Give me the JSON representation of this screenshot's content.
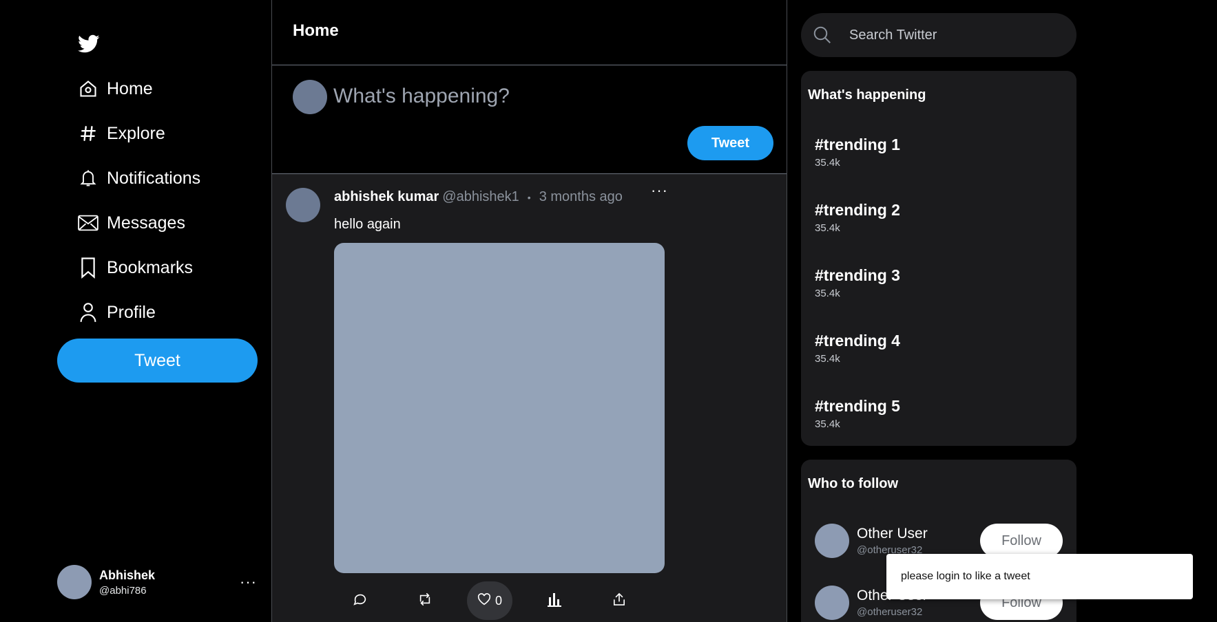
{
  "nav": {
    "items": [
      {
        "label": "Home",
        "icon": "home-icon"
      },
      {
        "label": "Explore",
        "icon": "hash-icon"
      },
      {
        "label": "Notifications",
        "icon": "bell-icon"
      },
      {
        "label": "Messages",
        "icon": "envelope-icon"
      },
      {
        "label": "Bookmarks",
        "icon": "bookmark-icon"
      },
      {
        "label": "Profile",
        "icon": "person-icon"
      }
    ],
    "tweet_button": "Tweet"
  },
  "account": {
    "name": "Abhishek",
    "handle": "@abhi786",
    "more": "···"
  },
  "main": {
    "title": "Home",
    "composer": {
      "placeholder": "What's happening?",
      "button": "Tweet"
    },
    "tweet": {
      "author": "abhishek kumar",
      "handle": "@abhishek1",
      "separator": "•",
      "time": "3 months ago",
      "more": "···",
      "text": "hello again",
      "like_count": "0"
    }
  },
  "search": {
    "placeholder": "Search Twitter"
  },
  "trending": {
    "title": "What's happening",
    "items": [
      {
        "tag": "#trending 1",
        "count": "35.4k"
      },
      {
        "tag": "#trending 2",
        "count": "35.4k"
      },
      {
        "tag": "#trending 3",
        "count": "35.4k"
      },
      {
        "tag": "#trending 4",
        "count": "35.4k"
      },
      {
        "tag": "#trending 5",
        "count": "35.4k"
      }
    ]
  },
  "who_to_follow": {
    "title": "Who to follow",
    "users": [
      {
        "name": "Other User",
        "handle": "@otheruser32",
        "button": "Follow"
      },
      {
        "name": "Other User",
        "handle": "@otheruser32",
        "button": "Follow"
      }
    ]
  },
  "toast": {
    "message": "please login to like a tweet"
  },
  "colors": {
    "accent": "#1d9bf0",
    "background": "#000000",
    "card": "#1b1b1d",
    "media": "#94a3b8"
  }
}
